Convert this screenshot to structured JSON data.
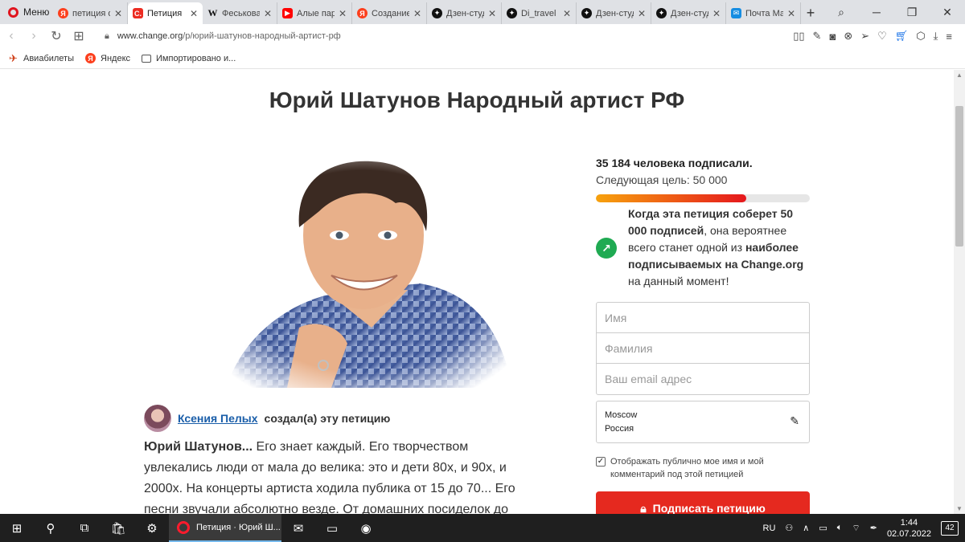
{
  "browser": {
    "menu_label": "Меню",
    "tabs": [
      {
        "icon": "yandex-icon",
        "label": "петиция о"
      },
      {
        "icon": "change-org-icon",
        "label": "Петиция"
      },
      {
        "icon": "wikipedia-icon",
        "label": "Феськова"
      },
      {
        "icon": "youtube-icon",
        "label": "Алые пар"
      },
      {
        "icon": "yandex-icon",
        "label": "Создание"
      },
      {
        "icon": "dzen-icon",
        "label": "Дзен-студ"
      },
      {
        "icon": "dzen-icon",
        "label": "Di_travel"
      },
      {
        "icon": "dzen-icon",
        "label": "Дзен-студ"
      },
      {
        "icon": "dzen-icon",
        "label": "Дзен-студ"
      },
      {
        "icon": "mail-icon",
        "label": "Почта Ма"
      }
    ],
    "active_tab_index": 1,
    "url_host": "www.change.org",
    "url_path": "/p/юрий-шатунов-народный-артист-рф",
    "bookmarks": [
      {
        "icon": "airplane-icon",
        "label": "Авиабилеты"
      },
      {
        "icon": "yandex-icon",
        "label": "Яндекс"
      },
      {
        "icon": "folder-icon",
        "label": "Импортировано и..."
      }
    ]
  },
  "petition": {
    "title": "Юрий Шатунов Народный артист РФ",
    "author_name": "Ксения Пелых",
    "author_suffix": "создал(а) эту петицию",
    "story_lead": "Юрий Шатунов...",
    "story_text": " Его знает каждый. Его творчеством увлекались люди от мала до велика: это и дети 80х, и 90х, и 2000х. На концерты артиста ходила публика от 15 до 70... Его песни звучали абсолютно везде. От домашних посиделок до",
    "signed_count": "35 184 человека подписали.",
    "next_goal": "Следующая цель: 50 000",
    "progress_fraction": 0.7037,
    "trend_bold_1": "Когда эта петиция соберет 50 000 подписей",
    "trend_text_1": ", она вероятнее всего станет одной из ",
    "trend_bold_2": "наиболее подписываемых на Change.org",
    "trend_text_2": " на данный момент!",
    "form": {
      "first_name_placeholder": "Имя",
      "last_name_placeholder": "Фамилия",
      "email_placeholder": "Ваш email адрес",
      "city": "Moscow",
      "country": "Россия",
      "consent_label": "Отображать публично мое имя и мой комментарий под этой петицией",
      "consent_checked": true,
      "sign_button": "Подписать петицию"
    }
  },
  "taskbar": {
    "active_app": "Петиция · Юрий Ш...",
    "language": "RU",
    "time": "1:44",
    "date": "02.07.2022",
    "notification_count": "42"
  },
  "colors": {
    "accent_red": "#e5291f",
    "progress_start": "#f7a20d",
    "progress_end": "#e5171d",
    "trend_green": "#1faa52",
    "link_blue": "#1a5ea9"
  }
}
